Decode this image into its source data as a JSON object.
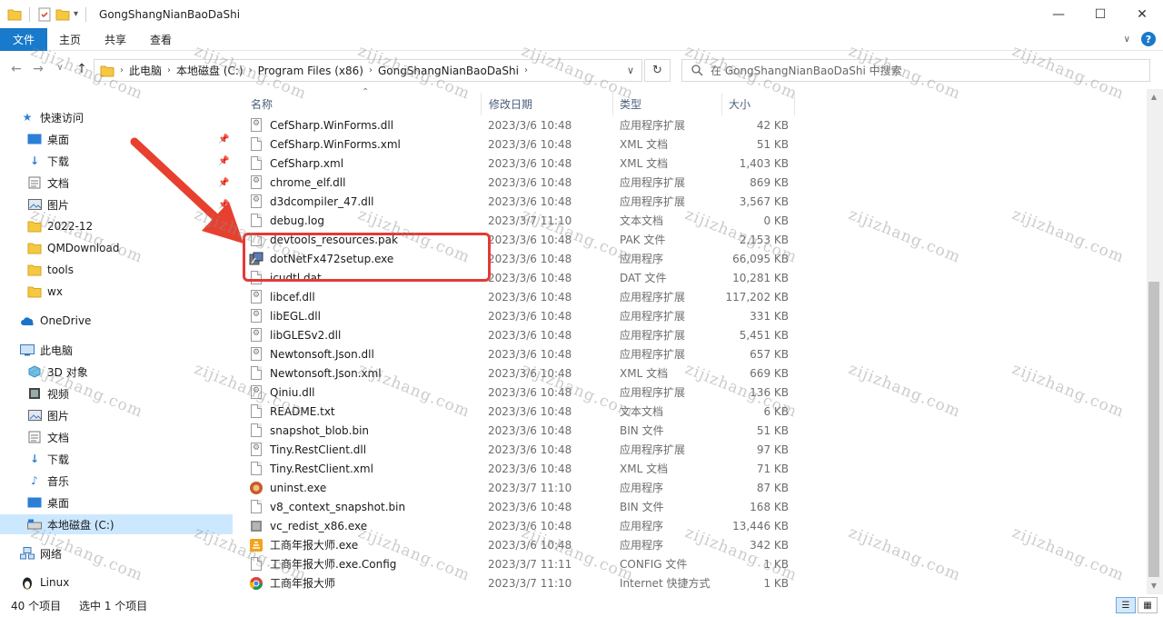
{
  "window": {
    "title": "GongShangNianBaoDaShi"
  },
  "ribbon": {
    "tabs": [
      "文件",
      "主页",
      "共享",
      "查看"
    ],
    "help": "?"
  },
  "address": {
    "crumbs": [
      "此电脑",
      "本地磁盘 (C:)",
      "Program Files (x86)",
      "GongShangNianBaoDaShi"
    ],
    "search_placeholder": "在 GongShangNianBaoDaShi 中搜索"
  },
  "columns": {
    "name": "名称",
    "date": "修改日期",
    "type": "类型",
    "size": "大小"
  },
  "sidebar": {
    "quick_access": "快速访问",
    "quick_items": [
      "桌面",
      "下载",
      "文档",
      "图片",
      "2022-12",
      "QMDownload",
      "tools",
      "wx"
    ],
    "onedrive": "OneDrive",
    "this_pc": "此电脑",
    "pc_items": [
      "3D 对象",
      "视频",
      "图片",
      "文档",
      "下载",
      "音乐",
      "桌面",
      "本地磁盘 (C:)"
    ],
    "network": "网络",
    "linux": "Linux"
  },
  "files": [
    {
      "name": "CefSharp.WinForms.dll",
      "date": "2023/3/6 10:48",
      "type": "应用程序扩展",
      "size": "42 KB",
      "icon": "gear-doc"
    },
    {
      "name": "CefSharp.WinForms.xml",
      "date": "2023/3/6 10:48",
      "type": "XML 文档",
      "size": "51 KB",
      "icon": "doc"
    },
    {
      "name": "CefSharp.xml",
      "date": "2023/3/6 10:48",
      "type": "XML 文档",
      "size": "1,403 KB",
      "icon": "doc"
    },
    {
      "name": "chrome_elf.dll",
      "date": "2023/3/6 10:48",
      "type": "应用程序扩展",
      "size": "869 KB",
      "icon": "gear-doc"
    },
    {
      "name": "d3dcompiler_47.dll",
      "date": "2023/3/6 10:48",
      "type": "应用程序扩展",
      "size": "3,567 KB",
      "icon": "gear-doc"
    },
    {
      "name": "debug.log",
      "date": "2023/3/7 11:10",
      "type": "文本文档",
      "size": "0 KB",
      "icon": "doc"
    },
    {
      "name": "devtools_resources.pak",
      "date": "2023/3/6 10:48",
      "type": "PAK 文件",
      "size": "2,153 KB",
      "icon": "doc"
    },
    {
      "name": "dotNetFx472setup.exe",
      "date": "2023/3/6 10:48",
      "type": "应用程序",
      "size": "66,095 KB",
      "icon": "setup"
    },
    {
      "name": "icudtl.dat",
      "date": "2023/3/6 10:48",
      "type": "DAT 文件",
      "size": "10,281 KB",
      "icon": "doc"
    },
    {
      "name": "libcef.dll",
      "date": "2023/3/6 10:48",
      "type": "应用程序扩展",
      "size": "117,202 KB",
      "icon": "gear-doc"
    },
    {
      "name": "libEGL.dll",
      "date": "2023/3/6 10:48",
      "type": "应用程序扩展",
      "size": "331 KB",
      "icon": "gear-doc"
    },
    {
      "name": "libGLESv2.dll",
      "date": "2023/3/6 10:48",
      "type": "应用程序扩展",
      "size": "5,451 KB",
      "icon": "gear-doc"
    },
    {
      "name": "Newtonsoft.Json.dll",
      "date": "2023/3/6 10:48",
      "type": "应用程序扩展",
      "size": "657 KB",
      "icon": "gear-doc"
    },
    {
      "name": "Newtonsoft.Json.xml",
      "date": "2023/3/6 10:48",
      "type": "XML 文档",
      "size": "669 KB",
      "icon": "doc"
    },
    {
      "name": "Qiniu.dll",
      "date": "2023/3/6 10:48",
      "type": "应用程序扩展",
      "size": "136 KB",
      "icon": "gear-doc"
    },
    {
      "name": "README.txt",
      "date": "2023/3/6 10:48",
      "type": "文本文档",
      "size": "6 KB",
      "icon": "doc"
    },
    {
      "name": "snapshot_blob.bin",
      "date": "2023/3/6 10:48",
      "type": "BIN 文件",
      "size": "51 KB",
      "icon": "doc"
    },
    {
      "name": "Tiny.RestClient.dll",
      "date": "2023/3/6 10:48",
      "type": "应用程序扩展",
      "size": "97 KB",
      "icon": "gear-doc"
    },
    {
      "name": "Tiny.RestClient.xml",
      "date": "2023/3/6 10:48",
      "type": "XML 文档",
      "size": "71 KB",
      "icon": "doc"
    },
    {
      "name": "uninst.exe",
      "date": "2023/3/7 11:10",
      "type": "应用程序",
      "size": "87 KB",
      "icon": "uninst"
    },
    {
      "name": "v8_context_snapshot.bin",
      "date": "2023/3/6 10:48",
      "type": "BIN 文件",
      "size": "168 KB",
      "icon": "doc"
    },
    {
      "name": "vc_redist_x86.exe",
      "date": "2023/3/6 10:48",
      "type": "应用程序",
      "size": "13,446 KB",
      "icon": "vc"
    },
    {
      "name": "工商年报大师.exe",
      "date": "2023/3/6 10:48",
      "type": "应用程序",
      "size": "342 KB",
      "icon": "app"
    },
    {
      "name": "工商年报大师.exe.Config",
      "date": "2023/3/7 11:11",
      "type": "CONFIG 文件",
      "size": "1 KB",
      "icon": "doc"
    },
    {
      "name": "工商年报大师",
      "date": "2023/3/7 11:10",
      "type": "Internet 快捷方式",
      "size": "1 KB",
      "icon": "chrome"
    }
  ],
  "status": {
    "count": "40 个项目",
    "selected": "选中 1 个项目"
  },
  "watermark": "zijizhang.com",
  "colors": {
    "accent": "#1979ca",
    "highlight": "#e53935"
  }
}
